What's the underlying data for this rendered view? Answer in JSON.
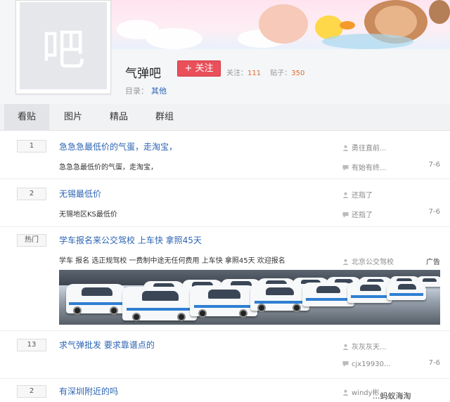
{
  "forum": {
    "avatar_char": "吧",
    "name": "气弹吧",
    "follow_label": "+ 关注",
    "follow_count_label": "关注：",
    "follow_count": "111",
    "post_count_label": "贴子：",
    "post_count": "350",
    "catalog_label": "目录：",
    "catalog_value": "其他"
  },
  "tabs": [
    "看贴",
    "图片",
    "精品",
    "群组"
  ],
  "threads": [
    {
      "replies": "1",
      "title": "急急急最低价的气蛋，走淘宝，",
      "abstract": "急急急最低价的气蛋，走淘宝，",
      "author": "勇往直前...",
      "last_reply": "有始有终...",
      "date": "7-6"
    },
    {
      "replies": "2",
      "title": "无锡最低价",
      "abstract": "无锡地区KS最低价",
      "author": "还指了",
      "last_reply": "还指了",
      "date": "7-6"
    },
    {
      "replies": "热门",
      "title": "学车报名来公交驾校 上车快 拿照45天",
      "abstract": "学车 报名 选正规驾校 一费制中途无任何费用 上车快 拿照45天 欢迎报名",
      "author": "北京公交驾校",
      "ad_label": "广告"
    },
    {
      "replies": "13",
      "title": "求气弹批发 要求靠谱点的",
      "author": "灰灰灰天...",
      "last_reply": "cjx19930...",
      "date": "7-6"
    },
    {
      "replies": "2",
      "title": "有深圳附近的吗",
      "author": "windy彬"
    }
  ],
  "watermark": "...蚂蚁海淘"
}
